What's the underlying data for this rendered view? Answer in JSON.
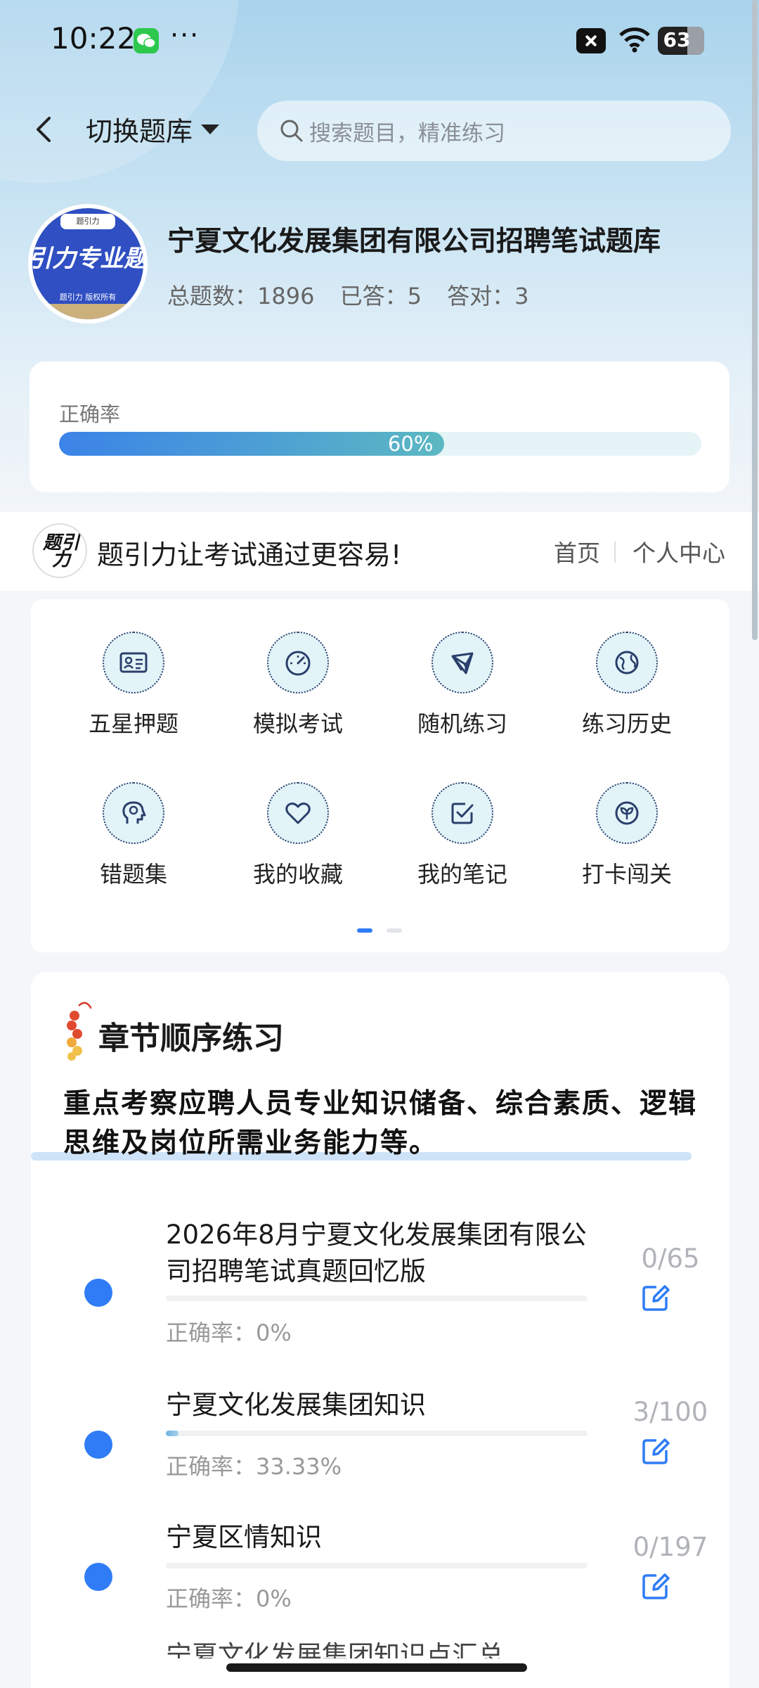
{
  "status_bar": {
    "time": "10:22",
    "more": "···",
    "battery": "63",
    "battery_level": 0.63,
    "icons": [
      "wechat-icon",
      "close-icon",
      "wifi-icon",
      "battery-icon"
    ]
  },
  "nav": {
    "switch_label": "切换题库",
    "search_placeholder": "搜索题目，精准练习"
  },
  "header": {
    "logo": {
      "top": "题引力",
      "main": "引力专业题",
      "sub": "题引力 版权所有"
    },
    "title": "宁夏文化发展集团有限公司招聘笔试题库",
    "stats": {
      "total": "总题数：1896",
      "answered": "已答：5",
      "correct": "答对：3"
    }
  },
  "accuracy": {
    "label": "正确率",
    "value_text": "60%",
    "value": 0.6
  },
  "brand": {
    "logo_text": "题引力",
    "slogan": "题引力让考试通过更容易!",
    "home": "首页",
    "user_center": "个人中心"
  },
  "features": [
    {
      "label": "五星押题",
      "icon": "id-card-icon"
    },
    {
      "label": "模拟考试",
      "icon": "speedometer-icon"
    },
    {
      "label": "随机练习",
      "icon": "network-icon"
    },
    {
      "label": "练习历史",
      "icon": "globe-icon"
    },
    {
      "label": "错题集",
      "icon": "head-icon"
    },
    {
      "label": "我的收藏",
      "icon": "heart-icon"
    },
    {
      "label": "我的笔记",
      "icon": "checkbox-icon"
    },
    {
      "label": "打卡闯关",
      "icon": "sprout-icon"
    }
  ],
  "pager": {
    "pages": 2,
    "current": 1
  },
  "chapters": {
    "title": "章节顺序练习",
    "description": "重点考察应聘人员专业知识储备、综合素质、逻辑思维及岗位所需业务能力等。",
    "items": [
      {
        "name": "2026年8月宁夏文化发展集团有限公司招聘笔试真题回忆版",
        "accuracy": "正确率：0%",
        "count": "0/65",
        "progress": 0.0
      },
      {
        "name": "宁夏文化发展集团知识",
        "accuracy": "正确率：33.33%",
        "count": "3/100",
        "progress": 0.03
      },
      {
        "name": "宁夏区情知识",
        "accuracy": "正确率：0%",
        "count": "0/197",
        "progress": 0.0
      }
    ],
    "peek": "宁夏文化发展集团知识点汇总"
  },
  "colors": {
    "accent": "#2f7cf6",
    "progress_start": "#3b83e8",
    "progress_end": "#5cb8c2"
  }
}
